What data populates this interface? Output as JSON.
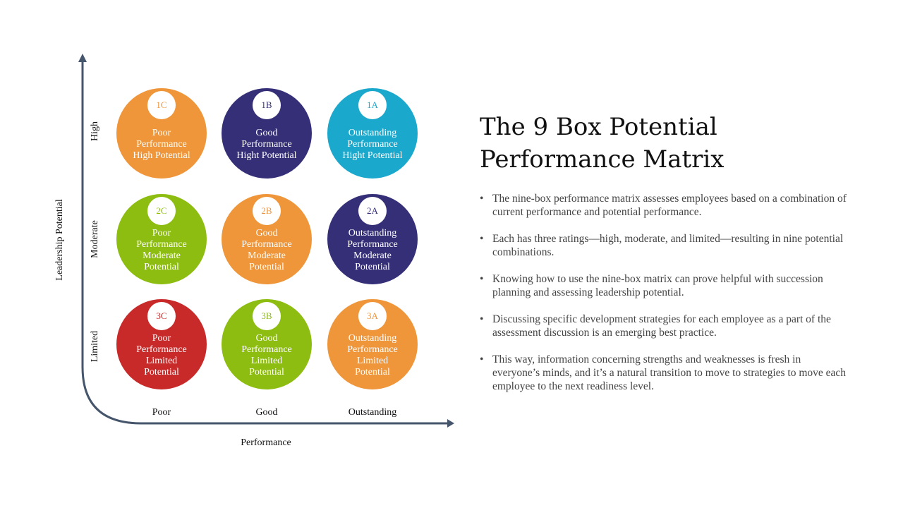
{
  "title": "The 9 Box Potential Performance Matrix",
  "title_lines": [
    "The 9 Box Potential",
    "Performance Matrix"
  ],
  "axes": {
    "y_title": "Leadership Potential",
    "y_levels": [
      "High",
      "Moderate",
      "Limited"
    ],
    "x_title": "Performance",
    "x_levels": [
      "Poor",
      "Good",
      "Outstanding"
    ]
  },
  "colors": {
    "orange": "#ef963a",
    "navy": "#352f78",
    "teal": "#1aa8cc",
    "green": "#8dbd10",
    "red": "#c82a2a",
    "axis": "#45556b"
  },
  "cells": [
    {
      "code": "1C",
      "color": "#ef963a",
      "lines": [
        "Poor",
        "Performance",
        "High Potential"
      ]
    },
    {
      "code": "1B",
      "color": "#352f78",
      "lines": [
        "Good",
        "Performance",
        "Hight Potential"
      ]
    },
    {
      "code": "1A",
      "color": "#1aa8cc",
      "lines": [
        "Outstanding",
        "Performance",
        "Hight Potential"
      ]
    },
    {
      "code": "2C",
      "color": "#8dbd10",
      "lines": [
        "Poor",
        "Performance",
        "Moderate",
        "Potential"
      ]
    },
    {
      "code": "2B",
      "color": "#ef963a",
      "lines": [
        "Good",
        "Performance",
        "Moderate",
        "Potential"
      ]
    },
    {
      "code": "2A",
      "color": "#352f78",
      "lines": [
        "Outstanding",
        "Performance",
        "Moderate",
        "Potential"
      ]
    },
    {
      "code": "3C",
      "color": "#c82a2a",
      "lines": [
        "Poor",
        "Performance",
        "Limited",
        "Potential"
      ]
    },
    {
      "code": "3B",
      "color": "#8dbd10",
      "lines": [
        "Good",
        "Performance",
        "Limited",
        "Potential"
      ]
    },
    {
      "code": "3A",
      "color": "#ef963a",
      "lines": [
        "Outstanding",
        "Performance",
        "Limited",
        "Potential"
      ]
    }
  ],
  "bullets": [
    "The nine-box performance matrix assesses employees based on a combination of current performance and potential performance.",
    "Each has three ratings—high, moderate, and limited—resulting in nine potential combinations.",
    "Knowing how to use the nine-box matrix can prove helpful with succession planning and assessing leadership potential.",
    "Discussing specific development strategies for each employee as a part of the assessment discussion is an emerging best practice.",
    "This way, information concerning strengths and weaknesses is fresh in everyone’s minds, and it’s a natural transition to move to strategies to move each employee to the next readiness level."
  ],
  "bullet_glyph": "•"
}
